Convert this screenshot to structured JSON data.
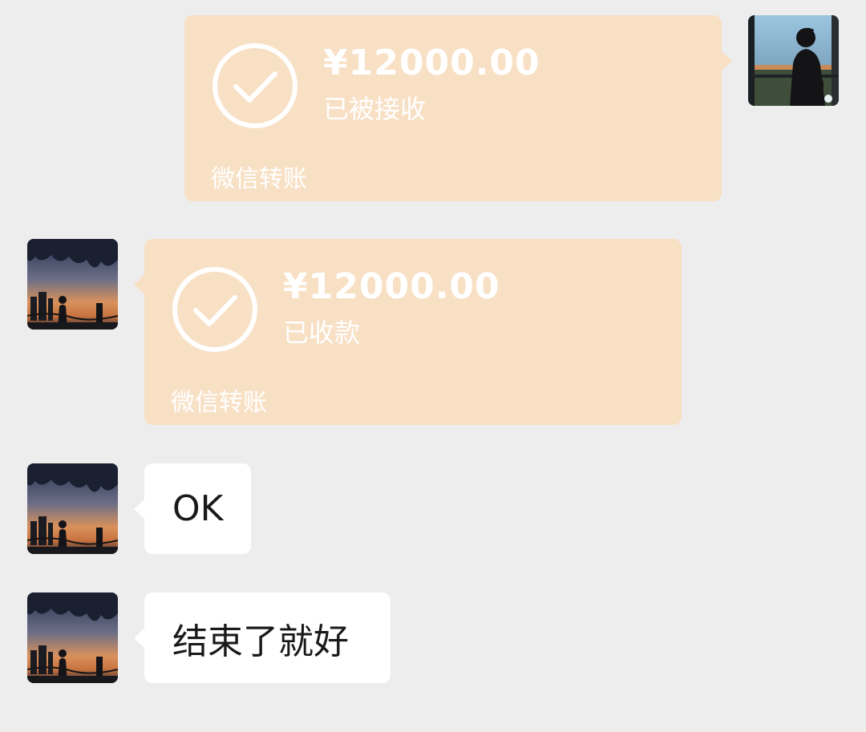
{
  "messages": [
    {
      "side": "right",
      "type": "transfer",
      "amount": "¥12000.00",
      "status": "已被接收",
      "footer": "微信转账",
      "avatar": "silhouette-window-avatar"
    },
    {
      "side": "left",
      "type": "transfer",
      "amount": "¥12000.00",
      "status": "已收款",
      "footer": "微信转账",
      "avatar": "sunset-silhouette-avatar"
    },
    {
      "side": "left",
      "type": "text",
      "text": "OK",
      "avatar": "sunset-silhouette-avatar"
    },
    {
      "side": "left",
      "type": "text",
      "text": "结束了就好",
      "avatar": "sunset-silhouette-avatar"
    }
  ],
  "colors": {
    "background": "#ededed",
    "transfer_bubble": "#f8e0c5",
    "text_bubble": "#ffffff",
    "text": "#191919"
  }
}
